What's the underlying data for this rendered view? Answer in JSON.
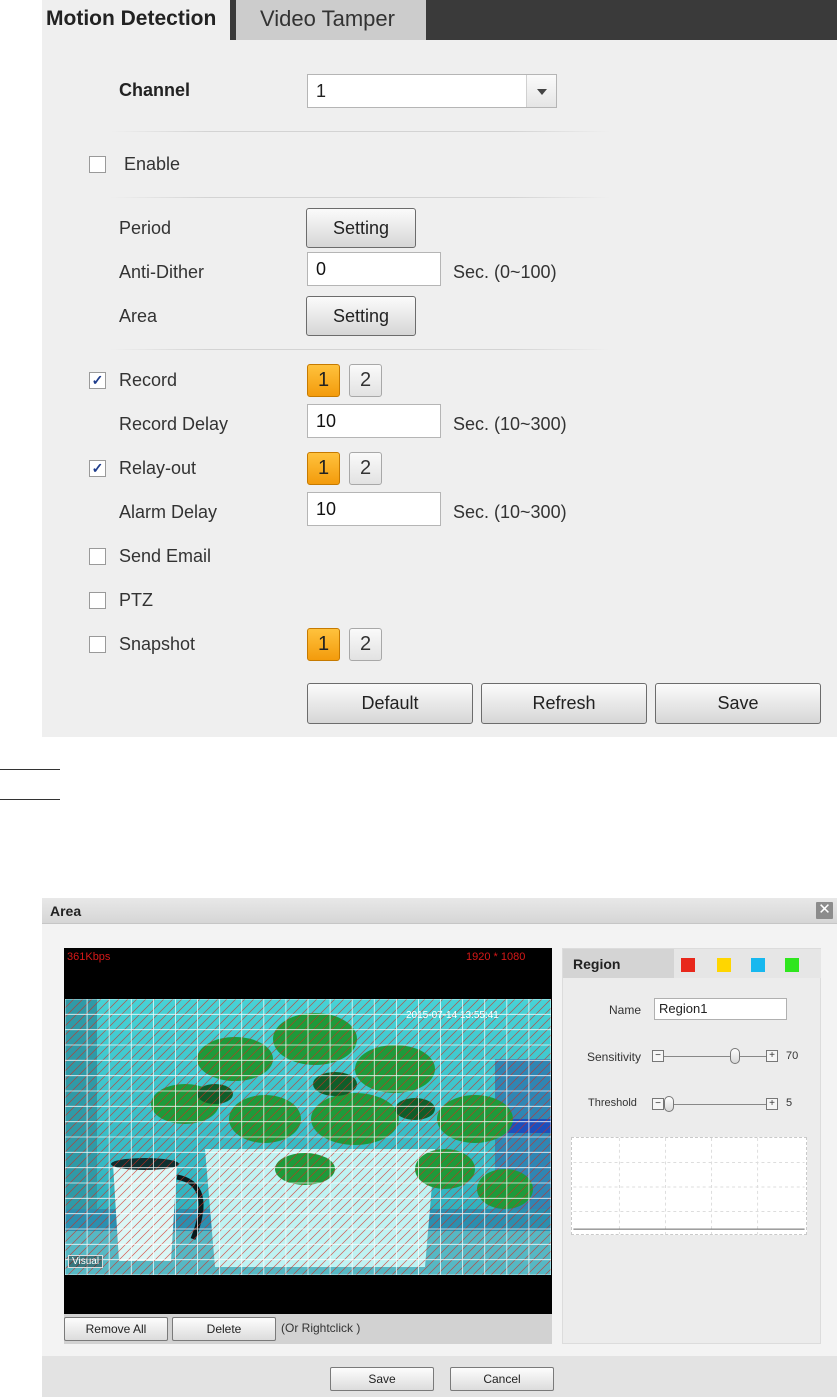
{
  "tabs": [
    {
      "label": "Motion Detection",
      "active": true
    },
    {
      "label": "Video Tamper",
      "active": false
    }
  ],
  "form": {
    "channel_label": "Channel",
    "channel_value": "1",
    "enable_label": "Enable",
    "enable_checked": false,
    "period_label": "Period",
    "period_button": "Setting",
    "antidither_label": "Anti-Dither",
    "antidither_value": "0",
    "antidither_unit": "Sec. (0~100)",
    "area_label": "Area",
    "area_button": "Setting",
    "record_label": "Record",
    "record_checked": true,
    "record_channels": [
      "1",
      "2"
    ],
    "record_delay_label": "Record Delay",
    "record_delay_value": "10",
    "record_delay_unit": "Sec. (10~300)",
    "relay_label": "Relay-out",
    "relay_checked": true,
    "relay_channels": [
      "1",
      "2"
    ],
    "alarm_delay_label": "Alarm Delay",
    "alarm_delay_value": "10",
    "alarm_delay_unit": "Sec. (10~300)",
    "send_email_label": "Send Email",
    "send_email_checked": false,
    "ptz_label": "PTZ",
    "ptz_checked": false,
    "snapshot_label": "Snapshot",
    "snapshot_checked": false,
    "snapshot_channels": [
      "1",
      "2"
    ],
    "check_mark": "✓",
    "buttons": {
      "default": "Default",
      "refresh": "Refresh",
      "save": "Save"
    }
  },
  "area_dialog": {
    "title": "Area",
    "close_glyph": "✕",
    "video": {
      "bitrate": "361Kbps",
      "resolution": "1920 * 1080",
      "timestamp": "2015-07-14 13:55:41",
      "mode": "Visual"
    },
    "remove_all": "Remove All",
    "delete": "Delete",
    "rightclick_note": "(Or Rightclick )",
    "region": {
      "tab_label": "Region",
      "colors": [
        "#e8281c",
        "#ffd600",
        "#17b8ef",
        "#2fe61e"
      ],
      "name_label": "Name",
      "name_value": "Region1",
      "sensitivity_label": "Sensitivity",
      "sensitivity_value": "70",
      "threshold_label": "Threshold",
      "threshold_value": "5",
      "minus": "−",
      "plus": "+"
    },
    "save": "Save",
    "cancel": "Cancel"
  },
  "colors": {
    "accent_orange": "#f7a81b",
    "grid_red": "#d8281c",
    "scene_cyan": "#3fd6d8"
  }
}
